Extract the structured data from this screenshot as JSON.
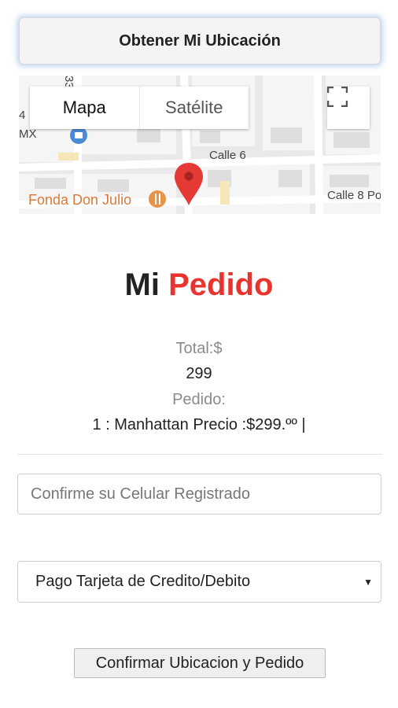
{
  "location_button": {
    "label": "Obtener Mi Ubicación"
  },
  "map": {
    "tabs": [
      {
        "label": "Mapa",
        "active": true
      },
      {
        "label": "Satélite",
        "active": false
      }
    ],
    "labels": {
      "street_1": "Calle 6",
      "street_2": "Calle 8 Po",
      "poi": "Fonda Don Julio",
      "edge_1": "MX",
      "edge_2": "4",
      "edge_3": "33"
    },
    "pin_color": "#e53935",
    "poi_color": "#d97a3b"
  },
  "order": {
    "title_part1": "Mi",
    "title_part2": "Pedido",
    "total_label": "Total:$",
    "total_value": "299",
    "pedido_label": "Pedido:",
    "pedido_items": "1 : Manhattan Precio :$299.ºº |"
  },
  "form": {
    "phone_placeholder": "Confirme su Celular Registrado",
    "payment_selected": "Pago Tarjeta de Credito/Debito",
    "confirm_label": "Confirmar Ubicacion y Pedido"
  },
  "colors": {
    "accent_red": "#e8332e"
  }
}
